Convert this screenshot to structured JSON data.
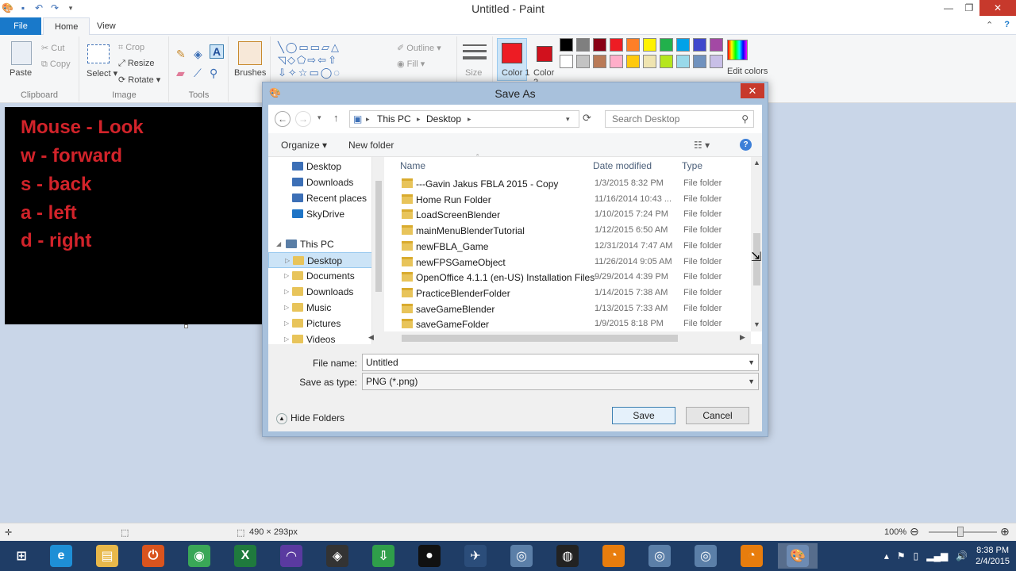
{
  "window": {
    "title": "Untitled - Paint"
  },
  "ribbon": {
    "tabs": [
      "File",
      "Home",
      "View"
    ],
    "clipboard": {
      "paste": "Paste",
      "cut": "Cut",
      "copy": "Copy",
      "group": "Clipboard"
    },
    "image": {
      "select": "Select",
      "crop": "Crop",
      "resize": "Resize",
      "rotate": "Rotate",
      "group": "Image"
    },
    "tools": {
      "group": "Tools"
    },
    "brushes": "Brushes",
    "shapes": {
      "outline": "Outline",
      "fill": "Fill"
    },
    "size": "Size",
    "color1": "Color 1",
    "color2": "Color 2",
    "edit_colors": "Edit colors",
    "palette_row1": [
      "#000000",
      "#7f7f7f",
      "#880015",
      "#ed1c24",
      "#ff7f27",
      "#fff200",
      "#22b14c",
      "#00a2e8",
      "#3f48cc",
      "#a349a4"
    ],
    "palette_row2": [
      "#ffffff",
      "#c3c3c3",
      "#b97a57",
      "#ffaec9",
      "#ffc90e",
      "#efe4b0",
      "#b5e61d",
      "#99d9ea",
      "#7092be",
      "#c8bfe7"
    ],
    "color1_value": "#ed1c24",
    "color2_value": "#d1111d"
  },
  "canvas": {
    "lines": [
      "Mouse - Look",
      "w - forward",
      "s - back",
      "a - left",
      "d - right"
    ],
    "text_color": "#d2232a"
  },
  "status": {
    "dimensions": "490 × 293px",
    "zoom": "100%"
  },
  "dialog": {
    "title": "Save As",
    "breadcrumb": [
      "This PC",
      "Desktop"
    ],
    "search_placeholder": "Search Desktop",
    "organize": "Organize ▾",
    "new_folder": "New folder",
    "nav_items": [
      {
        "label": "Desktop",
        "kind": "fav"
      },
      {
        "label": "Downloads",
        "kind": "fav"
      },
      {
        "label": "Recent places",
        "kind": "fav"
      },
      {
        "label": "SkyDrive",
        "kind": "cloud"
      },
      {
        "label": "This PC",
        "kind": "pc"
      },
      {
        "label": "Desktop",
        "kind": "lib",
        "selected": true
      },
      {
        "label": "Documents",
        "kind": "lib"
      },
      {
        "label": "Downloads",
        "kind": "lib"
      },
      {
        "label": "Music",
        "kind": "lib"
      },
      {
        "label": "Pictures",
        "kind": "lib"
      },
      {
        "label": "Videos",
        "kind": "lib"
      }
    ],
    "columns": {
      "name": "Name",
      "date": "Date modified",
      "type": "Type"
    },
    "files": [
      {
        "name": "---Gavin Jakus FBLA 2015 - Copy",
        "date": "1/3/2015 8:32 PM",
        "type": "File folder"
      },
      {
        "name": "Home Run Folder",
        "date": "11/16/2014 10:43 ...",
        "type": "File folder"
      },
      {
        "name": "LoadScreenBlender",
        "date": "1/10/2015 7:24 PM",
        "type": "File folder"
      },
      {
        "name": "mainMenuBlenderTutorial",
        "date": "1/12/2015 6:50 AM",
        "type": "File folder"
      },
      {
        "name": "newFBLA_Game",
        "date": "12/31/2014 7:47 AM",
        "type": "File folder"
      },
      {
        "name": "newFPSGameObject",
        "date": "11/26/2014 9:05 AM",
        "type": "File folder"
      },
      {
        "name": "OpenOffice 4.1.1 (en-US) Installation Files",
        "date": "9/29/2014 4:39 PM",
        "type": "File folder"
      },
      {
        "name": "PracticeBlenderFolder",
        "date": "1/14/2015 7:38 AM",
        "type": "File folder"
      },
      {
        "name": "saveGameBlender",
        "date": "1/13/2015 7:33 AM",
        "type": "File folder"
      },
      {
        "name": "saveGameFolder",
        "date": "1/9/2015 8:18 PM",
        "type": "File folder"
      }
    ],
    "file_name_label": "File name:",
    "file_name_value": "Untitled",
    "save_type_label": "Save as type:",
    "save_type_value": "PNG (*.png)",
    "hide_folders": "Hide Folders",
    "save": "Save",
    "cancel": "Cancel"
  },
  "taskbar": {
    "apps": [
      "windows-logo-icon",
      "internet-explorer-icon",
      "file-explorer-icon",
      "power-icon",
      "chrome-icon",
      "excel-icon",
      "headphones-icon",
      "unity-icon",
      "download-icon",
      "record-icon",
      "jaws-icon",
      "app-icon",
      "obs-icon",
      "blender-icon",
      "app-icon",
      "app-icon",
      "blender-icon",
      "paint-icon"
    ],
    "time": "8:38 PM",
    "date": "2/4/2015"
  }
}
